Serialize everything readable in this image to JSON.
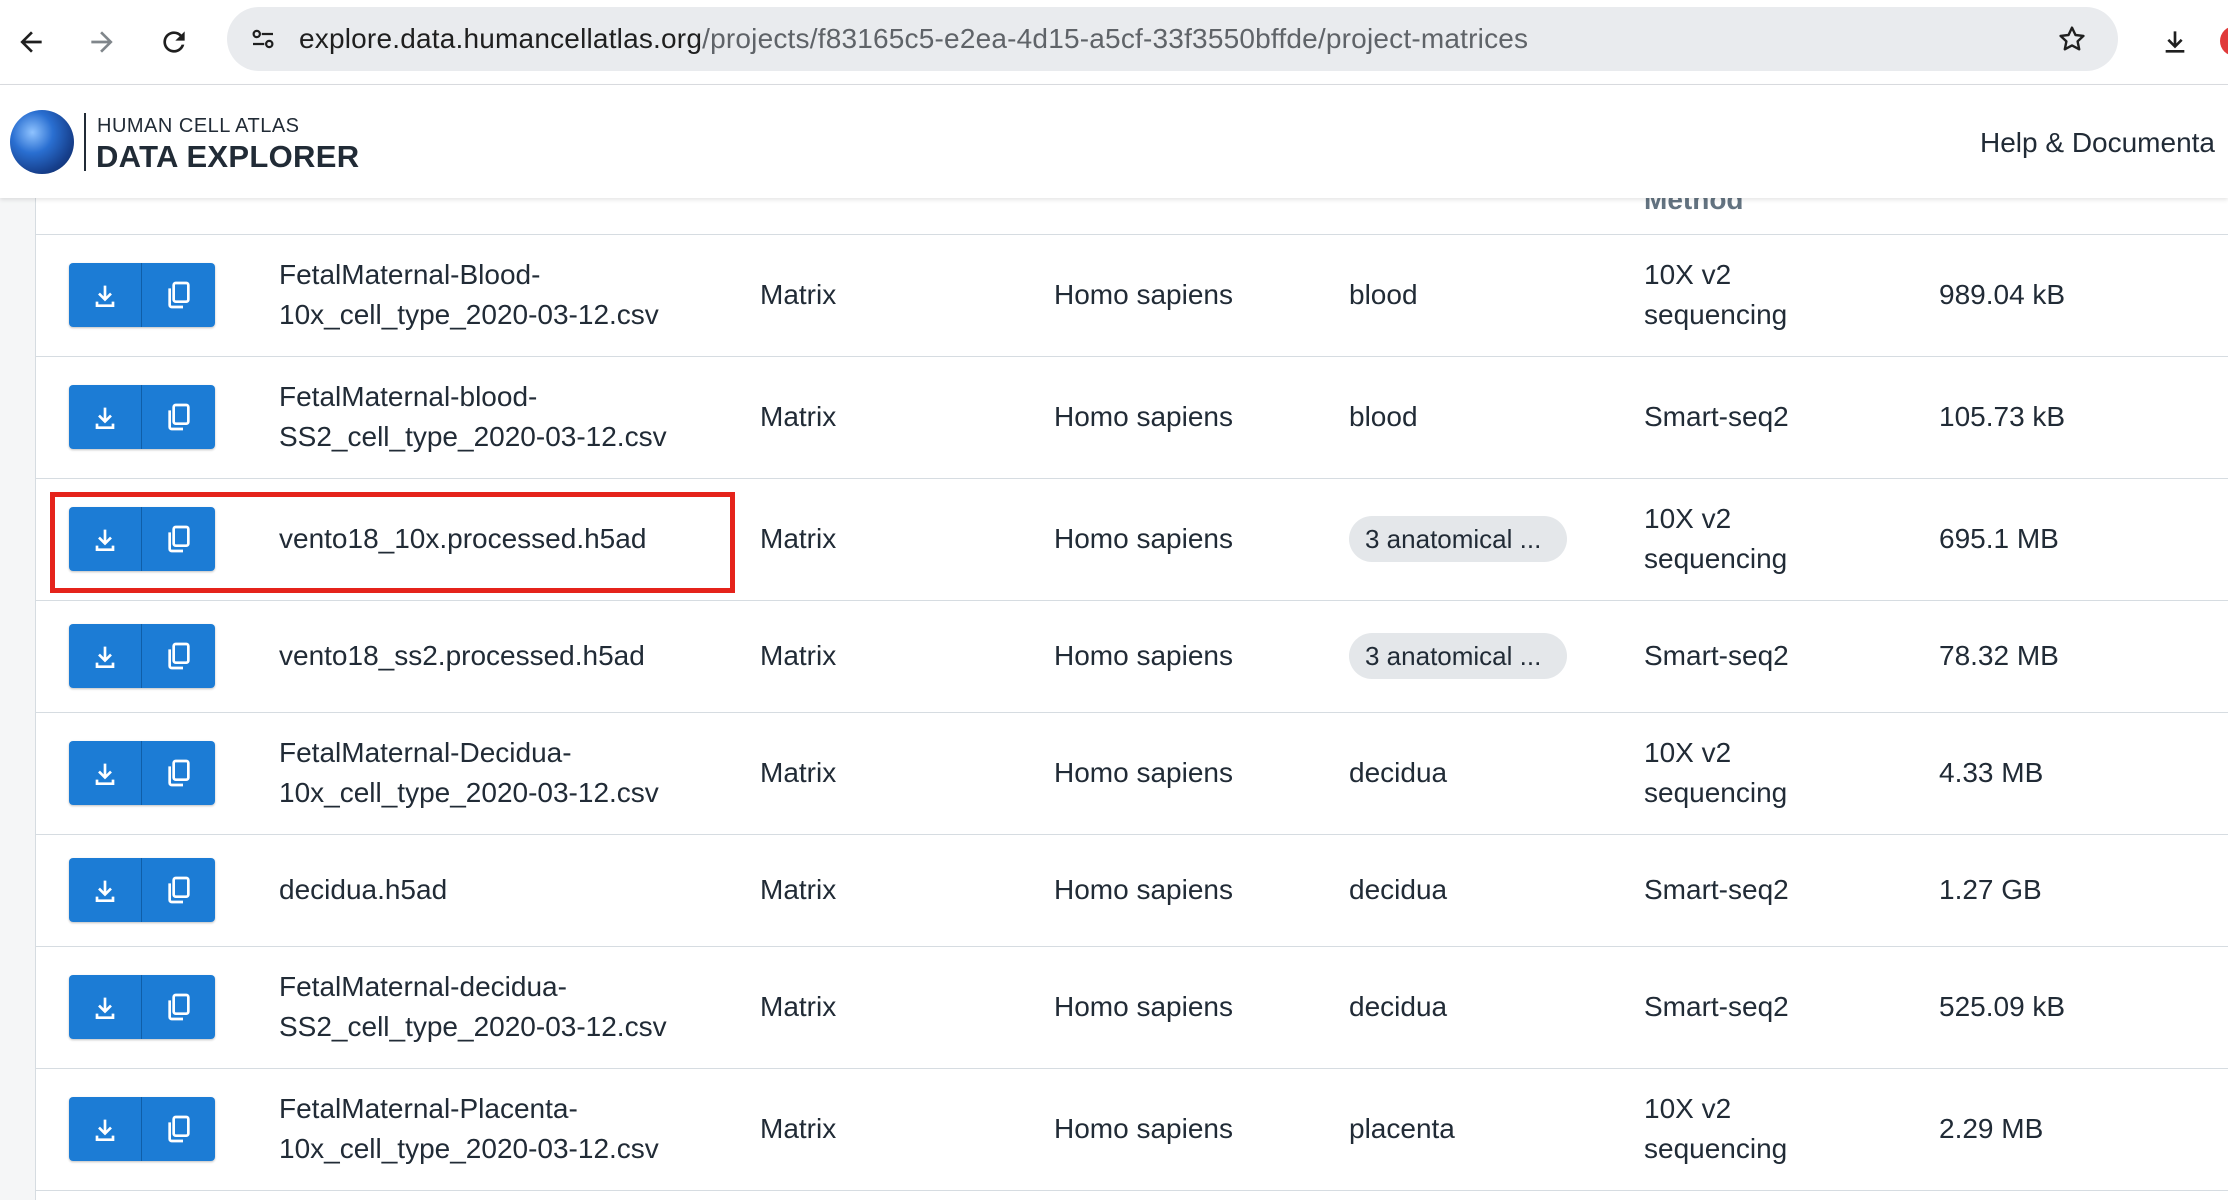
{
  "browser": {
    "url_host": "explore.data.humancellatlas.org",
    "url_path": "/projects/f83165c5-e2ea-4d15-a5cf-33f3550bffde/project-matrices"
  },
  "header": {
    "logo_line1": "HUMAN CELL ATLAS",
    "logo_line2": "DATA EXPLORER",
    "help_link": "Help & Documenta"
  },
  "table": {
    "partial_header": "Method",
    "rows": [
      {
        "name": "FetalMaternal-Blood-10x_cell_type_2020-03-12.csv",
        "type": "Matrix",
        "species": "Homo sapiens",
        "organ": "blood",
        "method": "10X v2 sequencing",
        "size": "989.04 kB"
      },
      {
        "name": "FetalMaternal-blood-SS2_cell_type_2020-03-12.csv",
        "type": "Matrix",
        "species": "Homo sapiens",
        "organ": "blood",
        "method": "Smart-seq2",
        "size": "105.73 kB"
      },
      {
        "name": "vento18_10x.processed.h5ad",
        "type": "Matrix",
        "species": "Homo sapiens",
        "organ": "3 anatomical ...",
        "method": "10X v2 sequencing",
        "size": "695.1 MB"
      },
      {
        "name": "vento18_ss2.processed.h5ad",
        "type": "Matrix",
        "species": "Homo sapiens",
        "organ": "3 anatomical ...",
        "method": "Smart-seq2",
        "size": "78.32 MB"
      },
      {
        "name": "FetalMaternal-Decidua-10x_cell_type_2020-03-12.csv",
        "type": "Matrix",
        "species": "Homo sapiens",
        "organ": "decidua",
        "method": "10X v2 sequencing",
        "size": "4.33 MB"
      },
      {
        "name": "decidua.h5ad",
        "type": "Matrix",
        "species": "Homo sapiens",
        "organ": "decidua",
        "method": "Smart-seq2",
        "size": "1.27 GB"
      },
      {
        "name": "FetalMaternal-decidua-SS2_cell_type_2020-03-12.csv",
        "type": "Matrix",
        "species": "Homo sapiens",
        "organ": "decidua",
        "method": "Smart-seq2",
        "size": "525.09 kB"
      },
      {
        "name": "FetalMaternal-Placenta-10x_cell_type_2020-03-12.csv",
        "type": "Matrix",
        "species": "Homo sapiens",
        "organ": "placenta",
        "method": "10X v2 sequencing",
        "size": "2.29 MB"
      }
    ]
  },
  "colors": {
    "button_blue": "#1c7cd5",
    "highlight_red": "#e5231b",
    "chip_gray": "#e4e7ea"
  }
}
